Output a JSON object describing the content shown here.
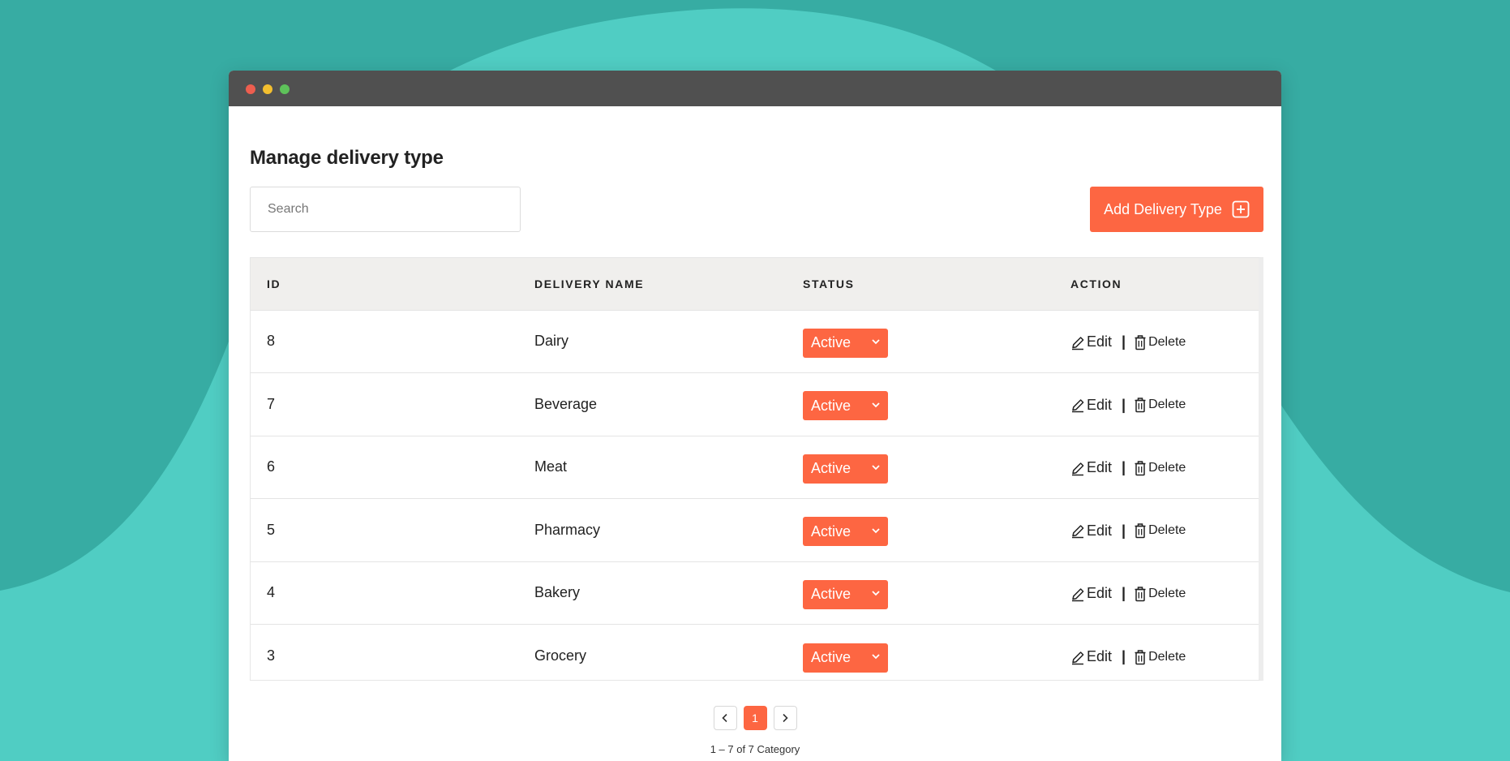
{
  "colors": {
    "background": "#37aca3",
    "background_light": "#50cdc3",
    "accent": "#fd6642",
    "titlebar": "#505050",
    "table_header_bg": "#f0efed"
  },
  "page": {
    "title": "Manage delivery type"
  },
  "search": {
    "placeholder": "Search",
    "value": ""
  },
  "add_button": {
    "label": "Add Delivery Type",
    "icon": "plus-square-icon"
  },
  "table": {
    "columns": [
      "ID",
      "DELIVERY NAME",
      "STATUS",
      "ACTION"
    ],
    "rows": [
      {
        "id": "8",
        "name": "Dairy",
        "status": "Active",
        "edit": "Edit",
        "delete": "Delete"
      },
      {
        "id": "7",
        "name": "Beverage",
        "status": "Active",
        "edit": "Edit",
        "delete": "Delete"
      },
      {
        "id": "6",
        "name": "Meat",
        "status": "Active",
        "edit": "Edit",
        "delete": "Delete"
      },
      {
        "id": "5",
        "name": "Pharmacy",
        "status": "Active",
        "edit": "Edit",
        "delete": "Delete"
      },
      {
        "id": "4",
        "name": "Bakery",
        "status": "Active",
        "edit": "Edit",
        "delete": "Delete"
      },
      {
        "id": "3",
        "name": "Grocery",
        "status": "Active",
        "edit": "Edit",
        "delete": "Delete"
      }
    ],
    "action_separator": "|"
  },
  "pagination": {
    "current_page": "1",
    "range_text": "1 – 7 of 7 Category"
  }
}
